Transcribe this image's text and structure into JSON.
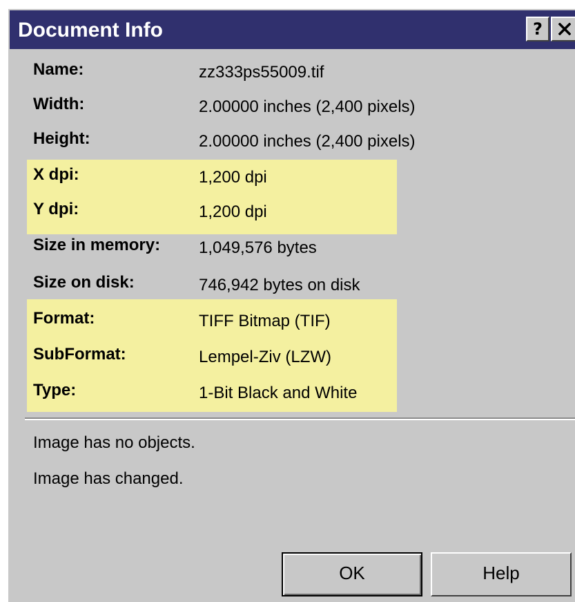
{
  "window": {
    "title": "Document Info",
    "help_button": "?",
    "close_button": "close"
  },
  "info": [
    {
      "label": "Name:",
      "value": "zz333ps55009.tif",
      "highlighted": false
    },
    {
      "label": "Width:",
      "value": "2.00000 inches  (2,400 pixels)",
      "highlighted": false
    },
    {
      "label": "Height:",
      "value": "2.00000 inches  (2,400 pixels)",
      "highlighted": false
    },
    {
      "label": "X dpi:",
      "value": "1,200 dpi",
      "highlighted": true
    },
    {
      "label": "Y dpi:",
      "value": "1,200 dpi",
      "highlighted": true
    },
    {
      "label": "Size in memory:",
      "value": "1,049,576 bytes",
      "highlighted": false
    },
    {
      "label": "Size on disk:",
      "value": "746,942 bytes on disk",
      "highlighted": false
    },
    {
      "label": "Format:",
      "value": "TIFF Bitmap (TIF)",
      "highlighted": true
    },
    {
      "label": "SubFormat:",
      "value": "Lempel-Ziv (LZW)",
      "highlighted": true
    },
    {
      "label": "Type:",
      "value": "1-Bit Black and White",
      "highlighted": true
    }
  ],
  "status": {
    "objects": "Image has no objects.",
    "changed": "Image has changed."
  },
  "buttons": {
    "ok": "OK",
    "help": "Help"
  },
  "colors": {
    "titlebar": "#30306e",
    "dialog_bg": "#c8c8c8",
    "highlight": "#f4f0a0"
  },
  "icons": {
    "close": "close-icon"
  }
}
